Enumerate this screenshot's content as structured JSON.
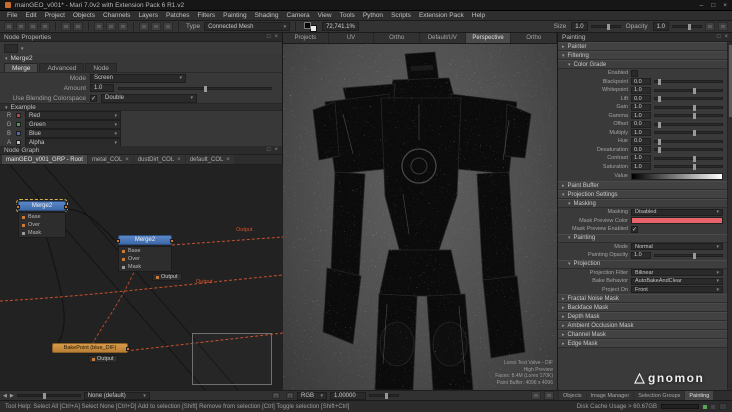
{
  "title_bar": {
    "title": "mainGEO_v001* - Mari 7.0v2 with Extension Pack 6 R1.v2",
    "minimize_icon": "–",
    "maximize_icon": "□",
    "close_icon": "×"
  },
  "menu_bar": {
    "items": [
      "File",
      "Edit",
      "Project",
      "Objects",
      "Channels",
      "Layers",
      "Patches",
      "Filters",
      "Painting",
      "Shading",
      "Camera",
      "View",
      "Tools",
      "Python",
      "Scripts",
      "Extension Pack",
      "Help"
    ]
  },
  "toolbar": {
    "icon_names": [
      "new-project",
      "open-project",
      "save-project",
      "close-project",
      "undo",
      "redo",
      "cut",
      "copy",
      "paste",
      "select-tool",
      "transform-tool",
      "paint-tool"
    ],
    "type_label": "Type",
    "type_value": "Connected Mesh",
    "zoom_value": "72,741.1%",
    "size_label": "Size",
    "size_value": "1.0",
    "opacity_label": "Opacity",
    "opacity_value": "1.0"
  },
  "node_properties": {
    "title": "Node Properties",
    "node_name": "Merge2",
    "tabs": [
      {
        "label": "Merge",
        "active": true
      },
      {
        "label": "Advanced"
      },
      {
        "label": "Node"
      }
    ],
    "mode_label": "Mode",
    "mode_value": "Screen",
    "amount_label": "Amount",
    "amount_value": "1.0",
    "blend_label": "Use Blending Colorspace",
    "blend_value": "Double",
    "group_label": "Example",
    "channels": [
      {
        "letter": "R",
        "color": "#b8493d",
        "value": "Red"
      },
      {
        "letter": "G",
        "color": "#4e9a4e",
        "value": "Green"
      },
      {
        "letter": "B",
        "color": "#4a6ab8",
        "value": "Blue"
      },
      {
        "letter": "A",
        "color": "#bdbdbd",
        "value": "Alpha"
      }
    ]
  },
  "node_graph": {
    "title": "Node Graph",
    "tabs": [
      {
        "label": "mainGEO_v001_GRP - Root",
        "active": true,
        "closable": false
      },
      {
        "label": "metal_COL"
      },
      {
        "label": "dustDirt_COL"
      },
      {
        "label": "default_COL"
      }
    ],
    "nodes": {
      "merge1": "Merge2",
      "merge2": "Merge2",
      "bakepoint": "BakePoint (blue_DIF)",
      "output_label": "Output"
    },
    "port_rows": [
      {
        "label": "Base",
        "color": "#cf7a33"
      },
      {
        "label": "Over",
        "color": "#cf7a33"
      },
      {
        "label": "Mask",
        "color": "#9a9a9a"
      }
    ],
    "bottom": {
      "filter_value": "None (default)"
    }
  },
  "viewport": {
    "tabs": [
      {
        "label": "Projects"
      },
      {
        "label": "UV"
      },
      {
        "label": "Ortho"
      },
      {
        "label": "Default/UV"
      },
      {
        "label": "Perspective",
        "active": true
      },
      {
        "label": "Ortho"
      }
    ],
    "hud_lines": [
      "Lores Test Valve - DIF",
      "High Preview",
      "Faces: 8.4M (Lores 170K)",
      "Paint Buffer: 4096 x 4096"
    ],
    "bottom": {
      "display_value": "RGB",
      "zoom_value": "1.00000"
    }
  },
  "right_panel": {
    "title": "Painting",
    "painter_section": "Painter",
    "filtering_section": "Filtering",
    "grade_section": "Color Grade",
    "enabled_label": "Enabled",
    "sliders": [
      {
        "label": "Blackpoint",
        "value": "0.0"
      },
      {
        "label": "Whitepoint",
        "value": "1.0"
      },
      {
        "label": "Lift",
        "value": "0.0"
      },
      {
        "label": "Gain",
        "value": "1.0"
      },
      {
        "label": "Gamma",
        "value": "1.0"
      },
      {
        "label": "Offset",
        "value": "0.0"
      },
      {
        "label": "Multiply",
        "value": "1.0"
      },
      {
        "label": "Hue",
        "value": "0.0"
      },
      {
        "label": "Desaturation",
        "value": "0.0"
      },
      {
        "label": "Contrast",
        "value": "1.0"
      },
      {
        "label": "Saturation",
        "value": "1.0"
      }
    ],
    "value_label": "Value",
    "paint_buffer_section": "Paint Buffer",
    "projection_settings_section": "Projection Settings",
    "masking_section": "Masking",
    "masking_label": "Masking",
    "masking_value": "Disabled",
    "mask_color_label": "Mask Preview Color",
    "mask_preview_color": "#e8636a",
    "mask_enabled_label": "Mask Preview Enabled",
    "painting_section": "Painting",
    "mode_label": "Mode",
    "mode_value": "Normal",
    "painting_opacity_label": "Painting Opacity",
    "painting_opacity_value": "1.0",
    "projection_section": "Projection",
    "projection_rows": [
      {
        "label": "Projection Filter",
        "value": "Bilinear"
      },
      {
        "label": "Bake Behavior",
        "value": "AutoBakeAndClear"
      },
      {
        "label": "Project On",
        "value": "Front"
      }
    ],
    "collapsed_sections": [
      "Fractal Noise Mask",
      "Backface Mask",
      "Depth Mask",
      "Ambient Occlusion Mask",
      "Channel Mask",
      "Edge Mask"
    ],
    "bottom_tabs": [
      {
        "label": "Objects"
      },
      {
        "label": "Image Manager"
      },
      {
        "label": "Selection Groups"
      },
      {
        "label": "Painting",
        "active": true
      }
    ]
  },
  "status_bar": {
    "tool_help": "Tool Help: Select All [Ctrl+A]    Select None [Ctrl+D]    Add to selection [Shift]    Remove from selection [Ctrl]    Toggle selection [Shift+Ctrl]",
    "disk_cache": "Disk Cache Usage > 60.67GB"
  },
  "watermark": {
    "text": "gnomon"
  }
}
